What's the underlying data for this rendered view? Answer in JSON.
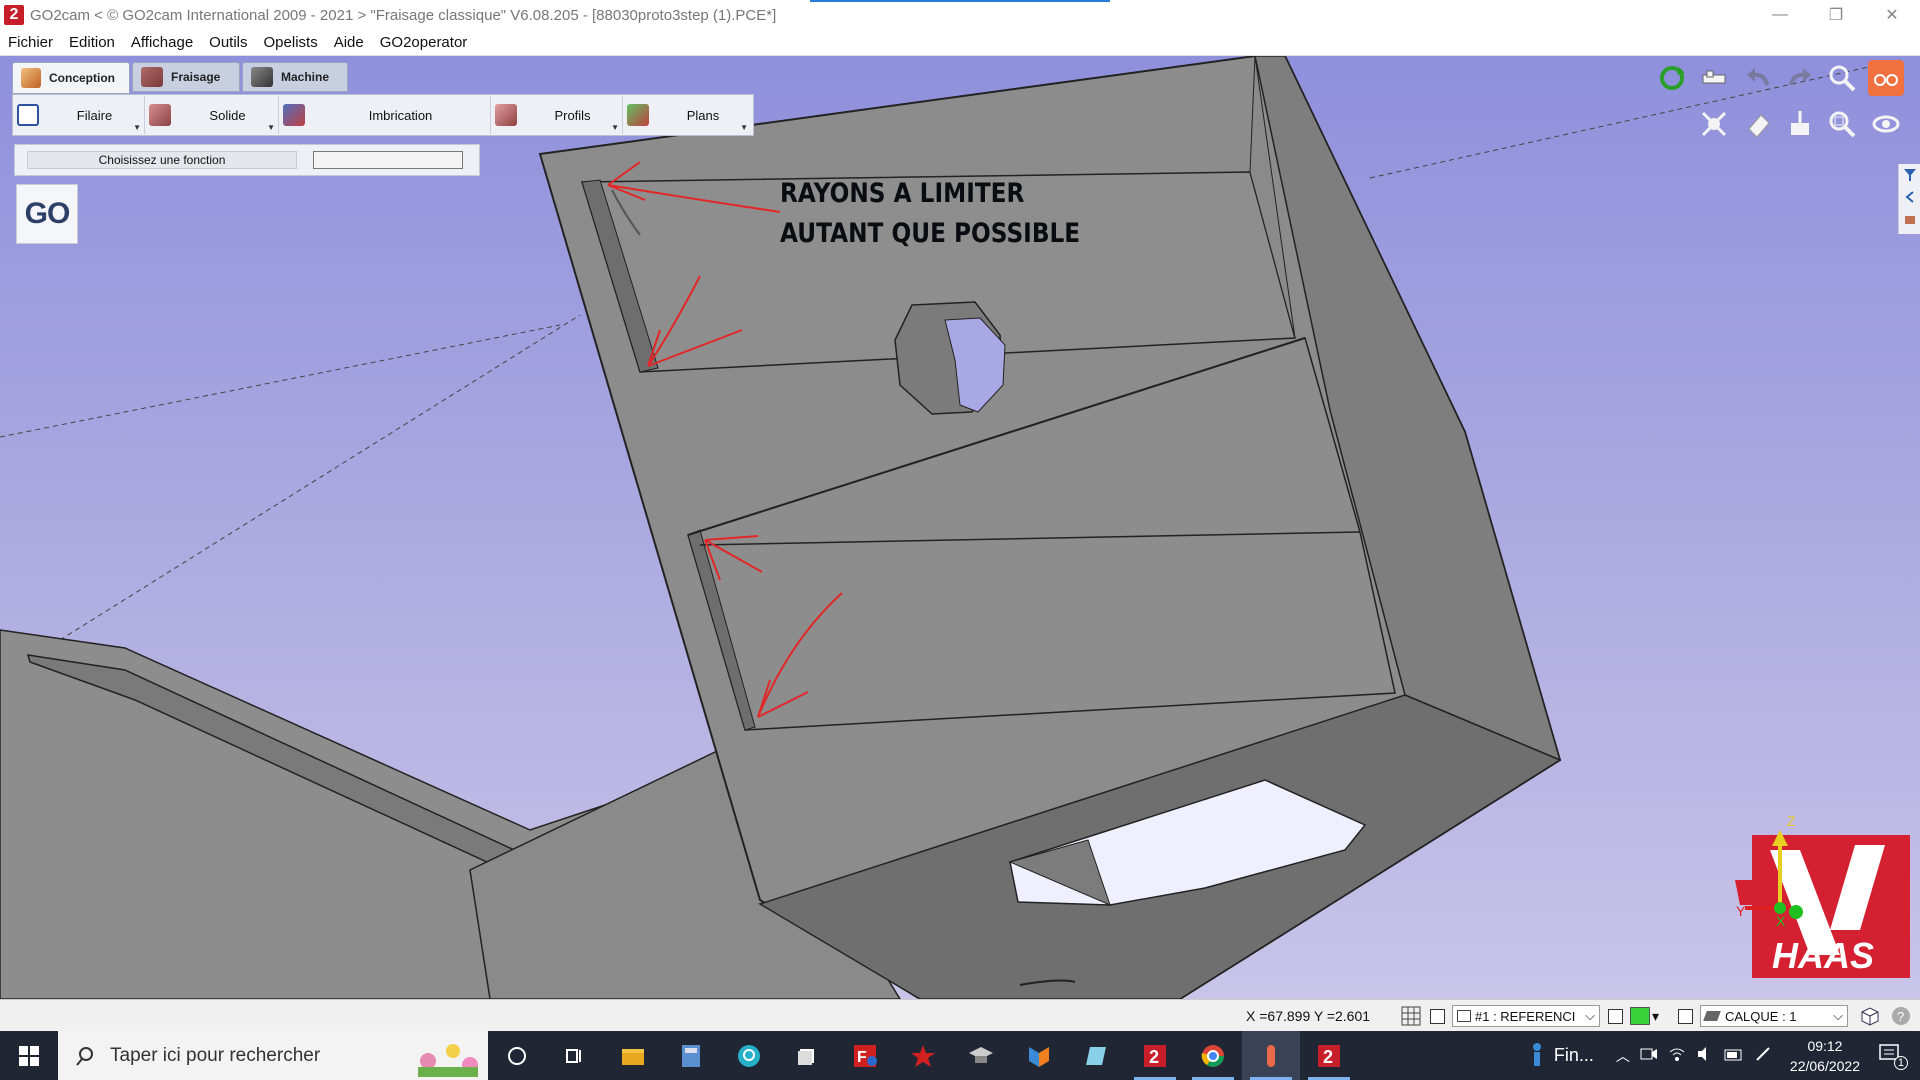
{
  "window": {
    "title": "GO2cam < © GO2cam International 2009 - 2021 >     \"Fraisage classique\"   V6.08.205 - [88030proto3step (1).PCE*]",
    "controls": {
      "minimize": "—",
      "restore": "❐",
      "close": "✕"
    }
  },
  "menu": {
    "items": [
      "Fichier",
      "Edition",
      "Affichage",
      "Outils",
      "Opelists",
      "Aide",
      "GO2operator"
    ]
  },
  "ribbon": {
    "tabs": [
      {
        "label": "Conception",
        "active": true,
        "icon": "conception-icon"
      },
      {
        "label": "Fraisage",
        "active": false,
        "icon": "milling-icon"
      },
      {
        "label": "Machine",
        "active": false,
        "icon": "machine-icon"
      }
    ],
    "tools": [
      {
        "label": "Filaire",
        "icon": "wireframe-icon"
      },
      {
        "label": "Solide",
        "icon": "solid-icon"
      },
      {
        "label": "Imbrication",
        "icon": "nesting-icon"
      },
      {
        "label": "Profils",
        "icon": "profiles-icon"
      },
      {
        "label": "Plans",
        "icon": "planes-icon"
      }
    ]
  },
  "function_bar": {
    "label": "Choisissez une fonction",
    "value": ""
  },
  "go_button": {
    "label": "GO"
  },
  "annotation": {
    "line1": "RAYONS A LIMITER",
    "line2": "AUTANT QUE POSSIBLE"
  },
  "logo": {
    "text": "HAAS"
  },
  "triad": {
    "x": "X",
    "y": "Y",
    "z": "Z"
  },
  "statusbar": {
    "coords": "X =67.899   Y =2.601",
    "reference": "#1 : REFERENCI",
    "layer": "CALQUE : 1",
    "accent_color": "#3cd23c"
  },
  "taskbar": {
    "search_placeholder": "Taper ici pour rechercher",
    "notification_label": "Fin...",
    "time": "09:12",
    "date": "22/06/2022",
    "notification_count": "1"
  },
  "colors": {
    "viewport_top": "#8f90dc",
    "part_face": "#8c8c8c",
    "annotation_red": "#e32626"
  }
}
